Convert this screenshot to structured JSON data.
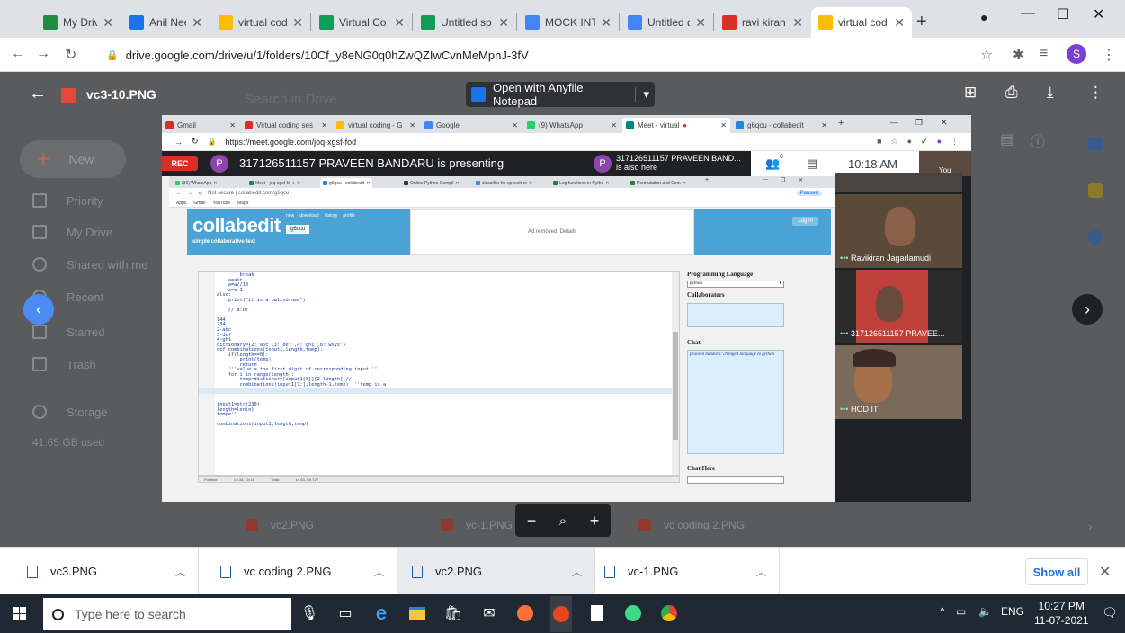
{
  "browser": {
    "tabs": [
      {
        "label": "My Drive - ",
        "color": "#1e8e3e"
      },
      {
        "label": "Anil Neeru",
        "color": "#1a73e8"
      },
      {
        "label": "virtual cod",
        "color": "#fbbc04"
      },
      {
        "label": "Virtual Co",
        "color": "#0f9d58"
      },
      {
        "label": "Untitled sp",
        "color": "#0f9d58"
      },
      {
        "label": "MOCK INT",
        "color": "#4285f4"
      },
      {
        "label": "Untitled d",
        "color": "#4285f4"
      },
      {
        "label": "ravi kiran",
        "color": "#d93025"
      },
      {
        "label": "virtual cod",
        "color": "#fbbc04"
      }
    ],
    "url": "drive.google.com/drive/u/1/folders/10Cf_y8eNG0q0hZwQZIwCvnMeMpnJ-3fV",
    "profile_initial": "S"
  },
  "drive": {
    "search_placeholder": "Search in Drive",
    "new_label": "New",
    "nav": [
      "Priority",
      "My Drive",
      "Shared with me",
      "Recent",
      "Starred",
      "Trash",
      "Storage"
    ],
    "storage_used": "41.65 GB used",
    "bottom_files": [
      "vc2.PNG",
      "vc-1.PNG",
      "vc coding 2.PNG"
    ]
  },
  "preview": {
    "file_name": "vc3-10.PNG",
    "open_with": "Open with Anyfile Notepad"
  },
  "screenshot": {
    "tabs": [
      {
        "label": "Gmail",
        "color": "#d93025"
      },
      {
        "label": "Virtual coding ses",
        "color": "#d93025"
      },
      {
        "label": "virtual coding - G",
        "color": "#fbbc04"
      },
      {
        "label": "Google",
        "color": "#4285f4"
      },
      {
        "label": "(9) WhatsApp",
        "color": "#25d366"
      },
      {
        "label": "Meet - virtual",
        "color": "#00897b"
      },
      {
        "label": "g6qcu - collabedit",
        "color": "#1e88e5"
      }
    ],
    "url": "https://meet.google.com/joq-xgsf-fod",
    "rec_label": "REC",
    "presenter_initial": "P",
    "presenting_text": "317126511157 PRAVEEN BANDARU is presenting",
    "also_here_name": "317126511157 PRAVEEN BAND...",
    "also_here_sub": "is also here",
    "participant_count": "6",
    "time": "10:18 AM",
    "self_label": "You",
    "participants": [
      "Ravikiran Jagarlamudi",
      "317126511157 PRAVEE...",
      "HOD IT"
    ]
  },
  "presentation": {
    "tabs": [
      {
        "label": "(36) WhatsApp",
        "color": "#25d366"
      },
      {
        "label": "Meet - joq-xgsf-fo",
        "color": "#00897b"
      },
      {
        "label": "g6qcu - collabedit",
        "color": "#1e88e5"
      },
      {
        "label": "Online Python Compil",
        "color": "#1e3a5f"
      },
      {
        "label": "classifier for speech re",
        "color": "#4285f4"
      },
      {
        "label": "Log functions in Pytho",
        "color": "#2e7d32"
      },
      {
        "label": "Permutation and Com",
        "color": "#2e7d32"
      }
    ],
    "url": "Not secure | collabedit.com/g6qcu",
    "bookmarks": [
      "Apps",
      "Gmail",
      "YouTube",
      "Maps"
    ],
    "profile_label": "Paused",
    "logo": "collabedit",
    "tagline": "simple collaborative text",
    "top_links": [
      "new",
      "download",
      "history",
      "profile"
    ],
    "doc_id": "g6qcu",
    "ad_text": "Ad removed. Details",
    "login": "Log In",
    "code": "        break\n    a=a%t\n    a=a//10\n    z=z-1\nelse:\n    print(\"it is a palindrome\")\n\n    // 8:07\n\n144\n234\n2-abc\n3-def\n4-ghi\ndictionary={2:'abc',3:'def',4:'ghi',8:'wxyz'}\ndef combinations(input1,length,temp):\n    if(length==0):\n        print(temp)\n        return\n    '''value = the first digit of corresponding input '''\n    for i in range(length):\n        temp=dictionary[input1[0]][2-length] //\n        combinations(input1[1:],length-1,temp) '''temp is a\n\n\n\ninput1=str(230)\nlength=len(n)\ntemp=''\n\ncombinations(input1,length,temp)",
    "status": [
      "Position:",
      "Ln 34, Ch 15",
      "Total:",
      "Ln 63, Ch 722"
    ],
    "side": {
      "lang_heading": "Programming Language",
      "lang_value": "python",
      "collab_heading": "Collaborators",
      "chat_heading": "Chat",
      "chat_message": "praveen bandaru: changed language to python",
      "chat_here": "Chat Here"
    }
  },
  "downloads": [
    {
      "name": "vc3.PNG"
    },
    {
      "name": "vc coding 2.PNG"
    },
    {
      "name": "vc2.PNG"
    },
    {
      "name": "vc-1.PNG"
    }
  ],
  "downloads_show_all": "Show all",
  "taskbar": {
    "search_placeholder": "Type here to search",
    "lang": "ENG",
    "time": "10:27 PM",
    "date": "11-07-2021"
  }
}
